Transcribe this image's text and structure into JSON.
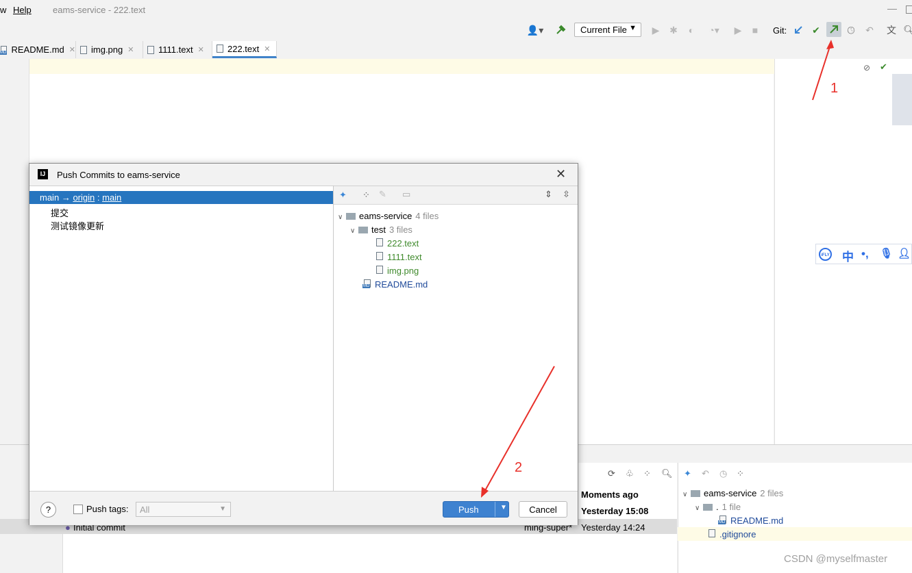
{
  "menubar": {
    "items": [
      "w",
      "Help"
    ],
    "window_title": "eams-service - 222.text",
    "minimize": "—"
  },
  "toolbar": {
    "run_config": "Current File",
    "git_label": "Git:"
  },
  "tabs": [
    {
      "label": "README.md",
      "icon": "markdown-file-icon"
    },
    {
      "label": "img.png",
      "icon": "image-file-icon"
    },
    {
      "label": "1111.text",
      "icon": "text-file-icon"
    },
    {
      "label": "222.text",
      "icon": "text-file-icon",
      "active": true
    }
  ],
  "dialog": {
    "title": "Push Commits to eams-service",
    "branch": {
      "local": "main",
      "arrow": "→",
      "remote": "origin",
      "sep": ":",
      "remote_branch": "main"
    },
    "commits": [
      "提交",
      "测试镜像更新"
    ],
    "tree": {
      "root": {
        "name": "eams-service",
        "count": "4 files"
      },
      "folder": {
        "name": "test",
        "count": "3 files"
      },
      "files": [
        "222.text",
        "1111.text",
        "img.png"
      ],
      "root_file": "README.md"
    },
    "footer": {
      "help": "?",
      "push_tags_label": "Push tags:",
      "push_tags_value": "All",
      "push": "Push",
      "cancel": "Cancel"
    }
  },
  "log": {
    "rows": [
      {
        "message": "",
        "author": "",
        "date": "Moments ago"
      },
      {
        "message": "",
        "author": "",
        "date": "Yesterday 15:08"
      },
      {
        "message": "Initial commit",
        "author": "ming-super*",
        "date": "Yesterday 14:24"
      }
    ]
  },
  "changes_panel": {
    "root": {
      "name": "eams-service",
      "count": "2 files"
    },
    "folder": {
      "name": ".",
      "count": "1 file"
    },
    "files": [
      "README.md",
      ".gitignore"
    ]
  },
  "ifly": {
    "logo": "iFLY",
    "items": [
      "中",
      "•,",
      "mic",
      "user"
    ]
  },
  "annotations": {
    "one": "1",
    "two": "2"
  },
  "watermark": "CSDN @myselfmaster",
  "colors": {
    "accent": "#2675bf",
    "added_file": "#3f8a2c",
    "modified_file": "#1f4a9a",
    "annotation": "#e8302a"
  }
}
